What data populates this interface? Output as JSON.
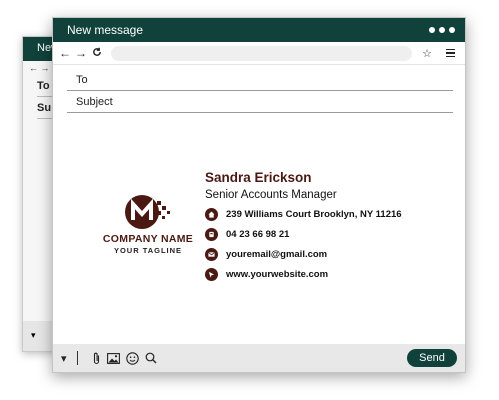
{
  "back_window": {
    "title": "New",
    "nav": "← →",
    "fields": [
      "To",
      "Su"
    ],
    "bottom_icon": "triangle-down-icon"
  },
  "window": {
    "title": "New message",
    "menu_dots_icon": "ellipsis-icon"
  },
  "browser": {
    "back_icon": "←",
    "forward_icon": "→",
    "reload_icon": "reload-icon",
    "bookmark_icon": "☆",
    "menu_icon": "hamburger-icon"
  },
  "compose": {
    "to_label": "To",
    "subject_label": "Subject"
  },
  "signature": {
    "logo_letter": "M",
    "company_name": "COMPANY NAME",
    "tagline": "YOUR TAGLINE",
    "name": "Sandra Erickson",
    "title": "Senior Accounts Manager",
    "address": "239 Williams Court Brooklyn, NY 11216",
    "phone": "04 23 66 98 21",
    "email": "youremail@gmail.com",
    "website": "www.yourwebsite.com",
    "accent_color": "#4a1a12"
  },
  "toolbar": {
    "send_label": "Send",
    "icons": [
      "triangle-down-icon",
      "attachment-icon",
      "image-icon",
      "emoji-icon",
      "search-icon"
    ]
  },
  "colors": {
    "brand": "#10423b",
    "accent": "#4a1a12"
  }
}
